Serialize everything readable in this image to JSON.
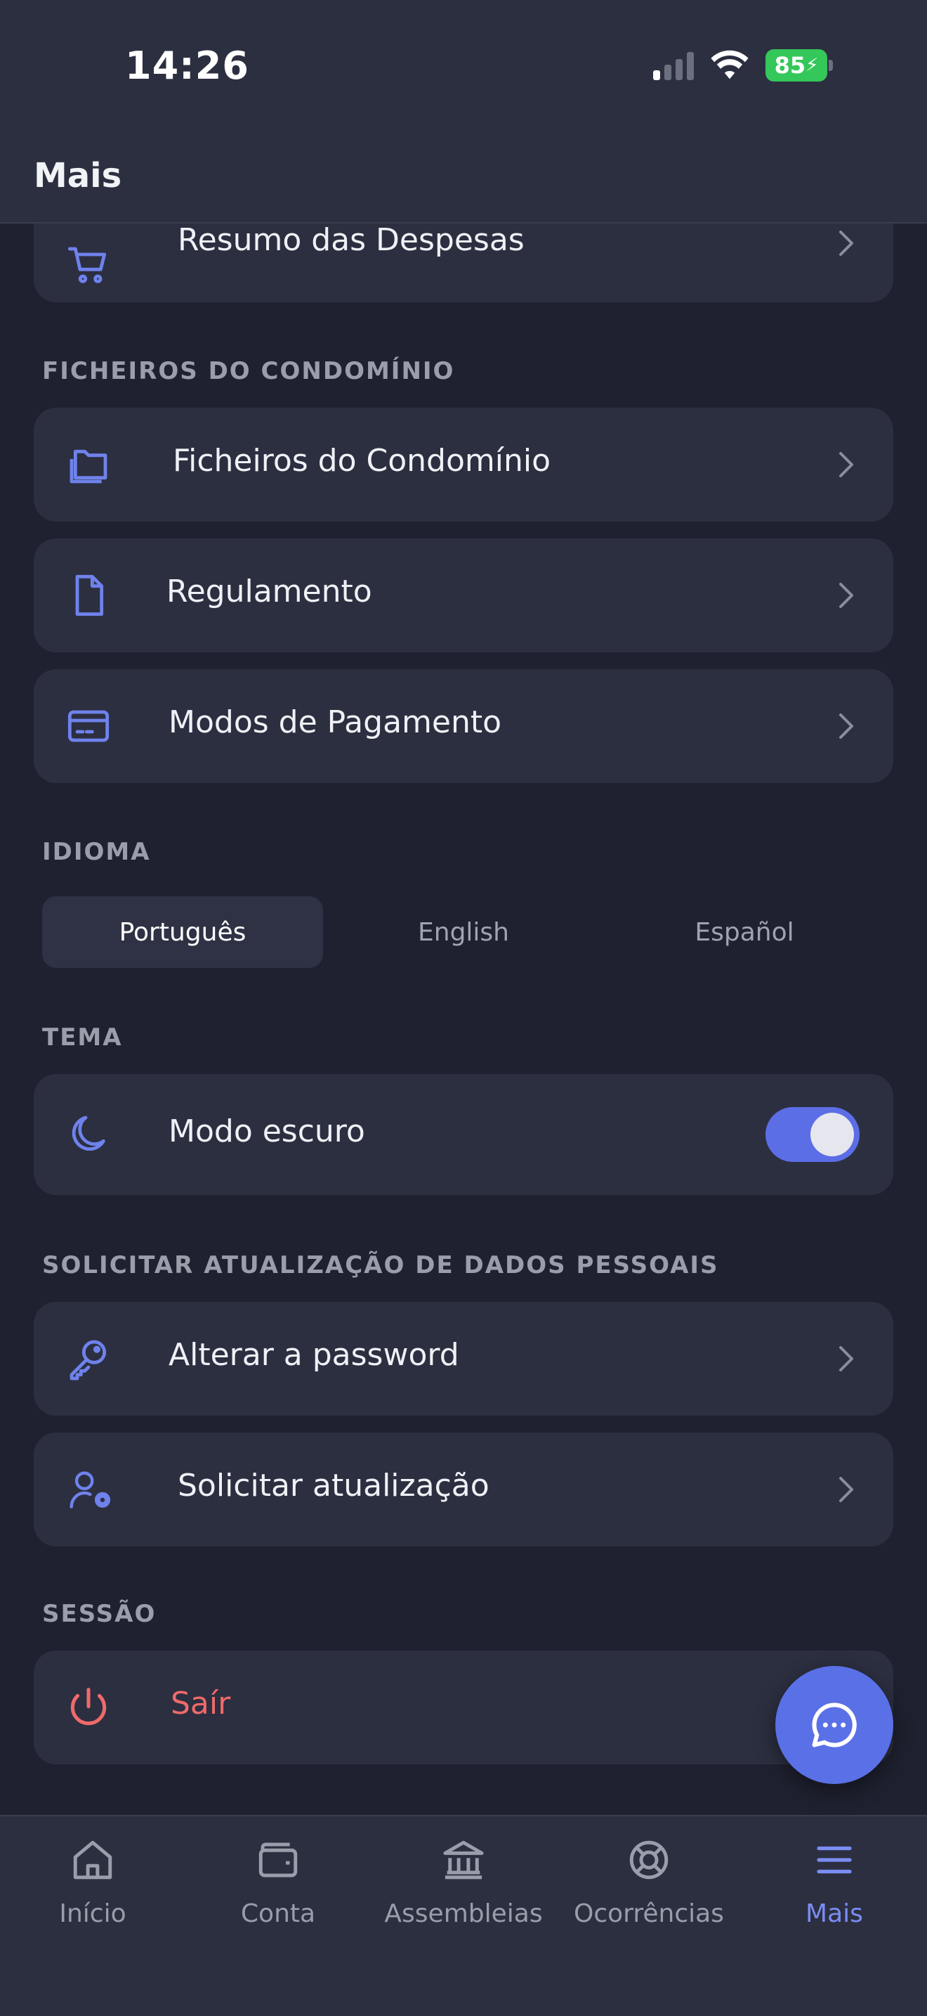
{
  "status_bar": {
    "time": "14:26",
    "battery": "85"
  },
  "header": {
    "title": "Mais"
  },
  "items": {
    "expenses": {
      "label": "Resumo das Despesas",
      "icon": "cart-icon"
    },
    "files": {
      "label": "Ficheiros do Condomínio",
      "icon": "folder-icon"
    },
    "regulation": {
      "label": "Regulamento",
      "icon": "document-icon"
    },
    "payment": {
      "label": "Modos de Pagamento",
      "icon": "credit-card-icon"
    }
  },
  "sections": {
    "files": "FICHEIROS DO CONDOMÍNIO",
    "language": "IDIOMA",
    "theme": "TEMA",
    "personal": "SOLICITAR ATUALIZAÇÃO DE DADOS PESSOAIS",
    "session": "SESSÃO"
  },
  "language": {
    "options": [
      "Português",
      "English",
      "Español"
    ],
    "selected": "Português"
  },
  "theme": {
    "label": "Modo escuro",
    "enabled": true
  },
  "personal": {
    "password": "Alterar a password",
    "update": "Solicitar atualização"
  },
  "session": {
    "logout": "Saír"
  },
  "tabs": [
    {
      "label": "Início",
      "icon": "home-icon"
    },
    {
      "label": "Conta",
      "icon": "wallet-icon"
    },
    {
      "label": "Assembleias",
      "icon": "bank-icon"
    },
    {
      "label": "Ocorrências",
      "icon": "lifebuoy-icon"
    },
    {
      "label": "Mais",
      "icon": "menu-icon",
      "active": true
    }
  ],
  "colors": {
    "accent": "#5c6ee6",
    "danger": "#ef6a6a",
    "card": "#2c2f40",
    "background": "#1f2130"
  }
}
